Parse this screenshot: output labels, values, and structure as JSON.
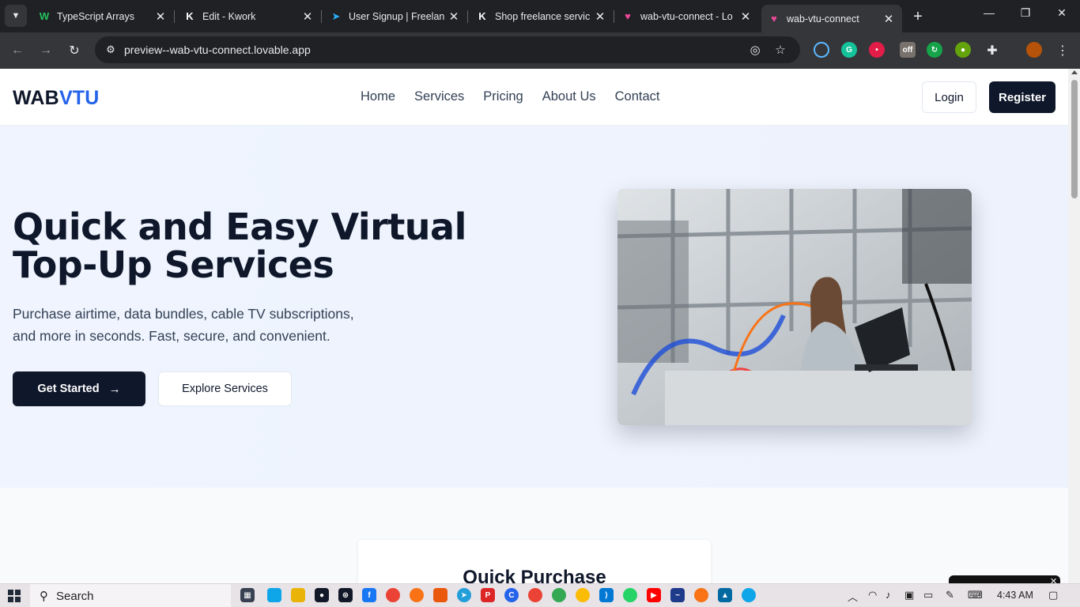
{
  "browser": {
    "tabs": [
      {
        "title": "TypeScript Arrays",
        "favicon": "w-icon",
        "favicon_char": "W",
        "favicon_color": "#22c55e"
      },
      {
        "title": "Edit - Kwork",
        "favicon": "kwork-icon",
        "favicon_char": "K",
        "favicon_color": "#ffffff"
      },
      {
        "title": "User Signup | Freelan",
        "favicon": "freelancer-icon",
        "favicon_char": "➤",
        "favicon_color": "#29b2fe"
      },
      {
        "title": "Shop freelance servic",
        "favicon": "kwork-icon",
        "favicon_char": "K",
        "favicon_color": "#ffffff"
      },
      {
        "title": "wab-vtu-connect - Lo",
        "favicon": "lovable-heart-icon",
        "favicon_char": "♥",
        "favicon_color": "#ec4899"
      },
      {
        "title": "wab-vtu-connect",
        "favicon": "lovable-heart-icon",
        "favicon_char": "♥",
        "favicon_color": "#ec4899",
        "active": true
      }
    ],
    "url": "preview--wab-vtu-connect.lovable.app"
  },
  "site": {
    "logo_main": "WAB",
    "logo_accent": "VTU",
    "nav": [
      "Home",
      "Services",
      "Pricing",
      "About Us",
      "Contact"
    ],
    "login_label": "Login",
    "register_label": "Register"
  },
  "hero": {
    "title": "Quick and Easy Virtual Top-Up Services",
    "subtitle": "Purchase airtime, data bundles, cable TV subscriptions, and more in seconds. Fast, secure, and convenient.",
    "cta_primary": "Get Started",
    "cta_secondary": "Explore Services"
  },
  "quick_purchase": {
    "title": "Quick Purchase"
  },
  "taskbar": {
    "search_label": "Search",
    "time": "4:43 AM"
  },
  "colors": {
    "brand_dark": "#0f172a",
    "brand_accent": "#2563eb",
    "hero_bg": "#eef3fd"
  }
}
